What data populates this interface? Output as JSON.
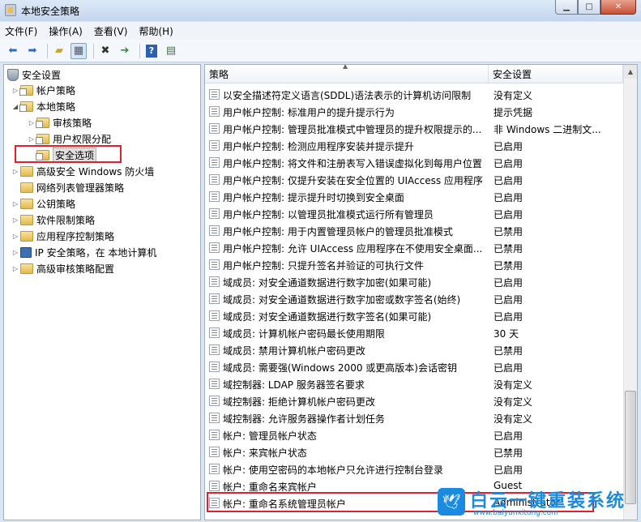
{
  "window": {
    "title": "本地安全策略"
  },
  "menu": [
    "文件(F)",
    "操作(A)",
    "查看(V)",
    "帮助(H)"
  ],
  "tree": [
    {
      "label": "安全设置",
      "level": 0,
      "expander": ""
    },
    {
      "label": "帐户策略",
      "level": 1,
      "expander": "▷"
    },
    {
      "label": "本地策略",
      "level": 1,
      "expander": "◢"
    },
    {
      "label": "审核策略",
      "level": 2,
      "expander": "▷"
    },
    {
      "label": "用户权限分配",
      "level": 2,
      "expander": "▷"
    },
    {
      "label": "安全选项",
      "level": 2,
      "expander": ""
    },
    {
      "label": "高级安全 Windows 防火墙",
      "level": 1,
      "expander": "▷"
    },
    {
      "label": "网络列表管理器策略",
      "level": 1,
      "expander": ""
    },
    {
      "label": "公钥策略",
      "level": 1,
      "expander": "▷"
    },
    {
      "label": "软件限制策略",
      "level": 1,
      "expander": "▷"
    },
    {
      "label": "应用程序控制策略",
      "level": 1,
      "expander": "▷"
    },
    {
      "label": "IP 安全策略，在 本地计算机",
      "level": 1,
      "expander": "▷"
    },
    {
      "label": "高级审核策略配置",
      "level": 1,
      "expander": "▷"
    }
  ],
  "columns": {
    "policy": "策略",
    "setting": "安全设置"
  },
  "rows": [
    {
      "policy": "以安全描述符定义语言(SDDL)语法表示的计算机访问限制",
      "setting": "没有定义"
    },
    {
      "policy": "用户帐户控制: 标准用户的提升提示行为",
      "setting": "提示凭据"
    },
    {
      "policy": "用户帐户控制: 管理员批准模式中管理员的提升权限提示的...",
      "setting": "非 Windows 二进制文..."
    },
    {
      "policy": "用户帐户控制: 检测应用程序安装并提示提升",
      "setting": "已启用"
    },
    {
      "policy": "用户帐户控制: 将文件和注册表写入错误虚拟化到每用户位置",
      "setting": "已启用"
    },
    {
      "policy": "用户帐户控制: 仅提升安装在安全位置的 UIAccess 应用程序",
      "setting": "已启用"
    },
    {
      "policy": "用户帐户控制: 提示提升时切换到安全桌面",
      "setting": "已启用"
    },
    {
      "policy": "用户帐户控制: 以管理员批准模式运行所有管理员",
      "setting": "已启用"
    },
    {
      "policy": "用户帐户控制: 用于内置管理员帐户的管理员批准模式",
      "setting": "已禁用"
    },
    {
      "policy": "用户帐户控制: 允许 UIAccess 应用程序在不使用安全桌面...",
      "setting": "已禁用"
    },
    {
      "policy": "用户帐户控制: 只提升签名并验证的可执行文件",
      "setting": "已禁用"
    },
    {
      "policy": "域成员: 对安全通道数据进行数字加密(如果可能)",
      "setting": "已启用"
    },
    {
      "policy": "域成员: 对安全通道数据进行数字加密或数字签名(始终)",
      "setting": "已启用"
    },
    {
      "policy": "域成员: 对安全通道数据进行数字签名(如果可能)",
      "setting": "已启用"
    },
    {
      "policy": "域成员: 计算机帐户密码最长使用期限",
      "setting": "30 天"
    },
    {
      "policy": "域成员: 禁用计算机帐户密码更改",
      "setting": "已禁用"
    },
    {
      "policy": "域成员: 需要强(Windows 2000 或更高版本)会话密钥",
      "setting": "已启用"
    },
    {
      "policy": "域控制器: LDAP 服务器签名要求",
      "setting": "没有定义"
    },
    {
      "policy": "域控制器: 拒绝计算机帐户密码更改",
      "setting": "没有定义"
    },
    {
      "policy": "域控制器: 允许服务器操作者计划任务",
      "setting": "没有定义"
    },
    {
      "policy": "帐户: 管理员帐户状态",
      "setting": "已启用"
    },
    {
      "policy": "帐户: 来宾帐户状态",
      "setting": "已禁用"
    },
    {
      "policy": "帐户: 使用空密码的本地帐户只允许进行控制台登录",
      "setting": "已启用"
    },
    {
      "policy": "帐户: 重命名来宾帐户",
      "setting": "Guest"
    },
    {
      "policy": "帐户: 重命名系统管理员帐户",
      "setting": "Administrator"
    }
  ],
  "watermark": {
    "text": "白云一键重装系统",
    "url": "www.baiyunxitong.com"
  }
}
